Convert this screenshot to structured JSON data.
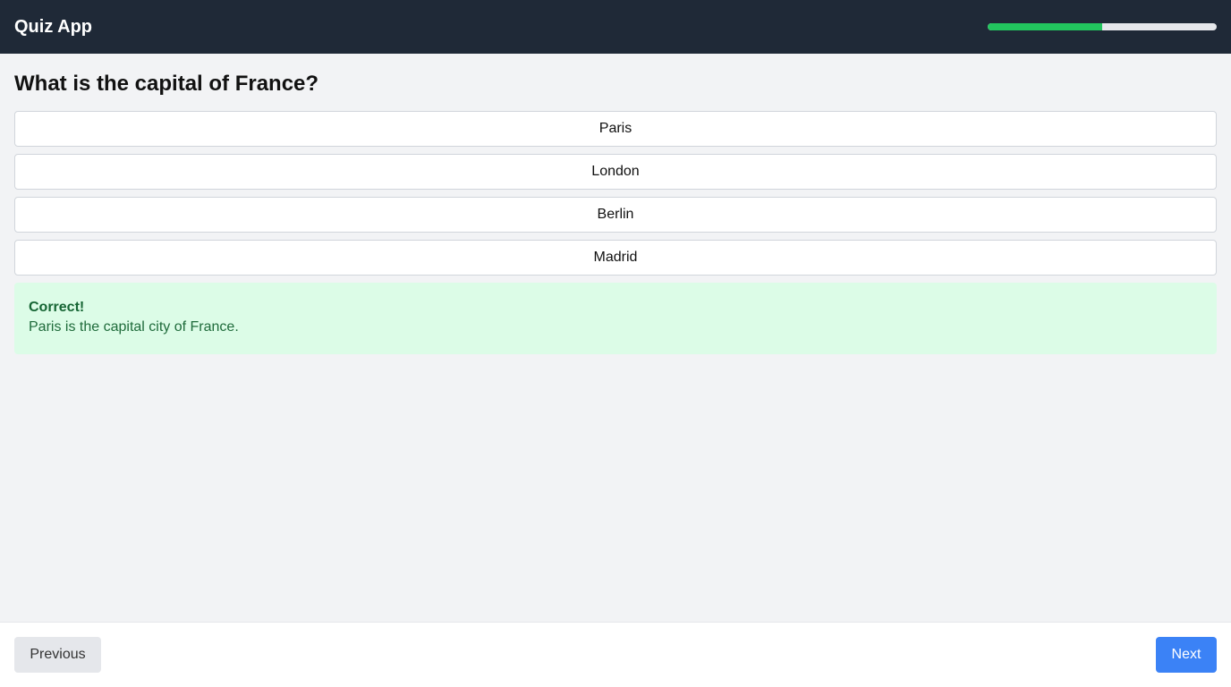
{
  "header": {
    "title": "Quiz App",
    "progress_fraction": 0.5,
    "progress_color": "#22c55e"
  },
  "question": {
    "text": "What is the capital of France?"
  },
  "options": [
    {
      "label": "Paris"
    },
    {
      "label": "London"
    },
    {
      "label": "Berlin"
    },
    {
      "label": "Madrid"
    }
  ],
  "feedback": {
    "title": "Correct!",
    "message": "Paris is the capital city of France.",
    "background": "#dcfce7"
  },
  "footer": {
    "previous_label": "Previous",
    "next_label": "Next",
    "accent": "#3b82f6"
  }
}
